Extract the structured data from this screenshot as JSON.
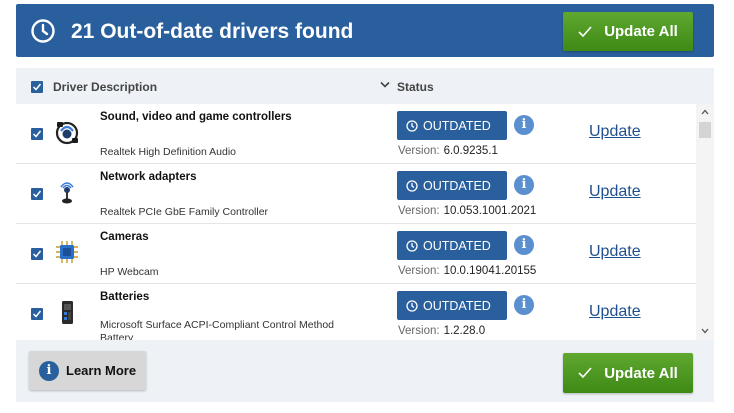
{
  "header": {
    "title": "21 Out-of-date drivers found",
    "update_all_label": "Update All",
    "icon": "clock-icon"
  },
  "columns": {
    "description": "Driver Description",
    "status": "Status"
  },
  "drivers": [
    {
      "category": "Sound, video and game controllers",
      "device": "Realtek High Definition Audio",
      "status": "OUTDATED",
      "version_label": "Version:",
      "version": "6.0.9235.1",
      "action": "Update",
      "icon": "audio-driver-icon",
      "checked": true
    },
    {
      "category": "Network adapters",
      "device": "Realtek PCIe GbE Family Controller",
      "status": "OUTDATED",
      "version_label": "Version:",
      "version": "10.053.1001.2021",
      "action": "Update",
      "icon": "network-adapter-icon",
      "checked": true
    },
    {
      "category": "Cameras",
      "device": "HP Webcam",
      "status": "OUTDATED",
      "version_label": "Version:",
      "version": "10.0.19041.20155",
      "action": "Update",
      "icon": "camera-chip-icon",
      "checked": true
    },
    {
      "category": "Batteries",
      "device": "Microsoft Surface ACPI-Compliant Control Method Battery",
      "status": "OUTDATED",
      "version_label": "Version:",
      "version": "1.2.28.0",
      "action": "Update",
      "icon": "battery-icon",
      "checked": true
    }
  ],
  "footer": {
    "learn_more_label": "Learn More",
    "update_all_label": "Update All"
  },
  "colors": {
    "header_blue": "#2a5f9e",
    "green_button": "#4c9a20",
    "link_blue": "#1f4f8f"
  }
}
